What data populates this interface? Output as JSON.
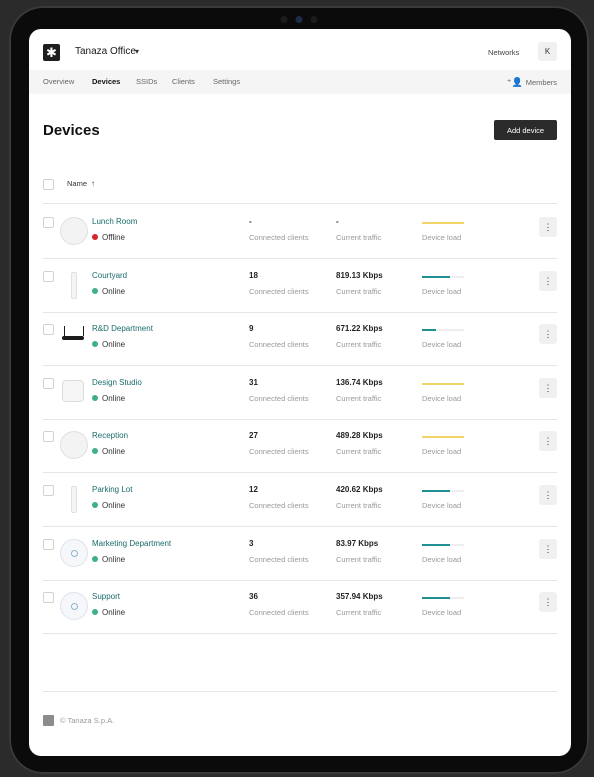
{
  "header": {
    "org_name": "Tanaza Office",
    "networks_label": "Networks",
    "avatar_initial": "K"
  },
  "tabs": [
    {
      "label": "Overview",
      "active": false
    },
    {
      "label": "Devices",
      "active": true
    },
    {
      "label": "SSIDs",
      "active": false
    },
    {
      "label": "Clients",
      "active": false
    },
    {
      "label": "Settings",
      "active": false
    }
  ],
  "members_label": "Members",
  "page": {
    "title": "Devices",
    "add_button": "Add device"
  },
  "table": {
    "column_name": "Name",
    "sort_arrow": "↑"
  },
  "devices": [
    {
      "name": "Lunch Room",
      "status": "Offline",
      "status_color": "#d7262b",
      "clients": "-",
      "traffic": "-",
      "clients_label": "Connected clients",
      "traffic_label": "Current traffic",
      "load_label": "Device load",
      "load": 1.0,
      "load_color": "#f1d46a",
      "thumb": "round"
    },
    {
      "name": "Courtyard",
      "status": "Online",
      "status_color": "#3fae8a",
      "clients": "18",
      "traffic": "819.13 Kbps",
      "clients_label": "Connected clients",
      "traffic_label": "Current traffic",
      "load_label": "Device load",
      "load": 0.67,
      "load_color": "#1f8f92",
      "thumb": "stick"
    },
    {
      "name": "R&D Department",
      "status": "Online",
      "status_color": "#3fae8a",
      "clients": "9",
      "traffic": "671.22 Kbps",
      "clients_label": "Connected clients",
      "traffic_label": "Current traffic",
      "load_label": "Device load",
      "load": 0.33,
      "load_color": "#1f8f92",
      "thumb": "router"
    },
    {
      "name": "Design Studio",
      "status": "Online",
      "status_color": "#3fae8a",
      "clients": "31",
      "traffic": "136.74 Kbps",
      "clients_label": "Connected clients",
      "traffic_label": "Current traffic",
      "load_label": "Device load",
      "load": 1.0,
      "load_color": "#f1d46a",
      "thumb": "square"
    },
    {
      "name": "Reception",
      "status": "Online",
      "status_color": "#3fae8a",
      "clients": "27",
      "traffic": "489.28 Kbps",
      "clients_label": "Connected clients",
      "traffic_label": "Current traffic",
      "load_label": "Device load",
      "load": 1.0,
      "load_color": "#f1d46a",
      "thumb": "round"
    },
    {
      "name": "Parking Lot",
      "status": "Online",
      "status_color": "#3fae8a",
      "clients": "12",
      "traffic": "420.62 Kbps",
      "clients_label": "Connected clients",
      "traffic_label": "Current traffic",
      "load_label": "Device load",
      "load": 0.67,
      "load_color": "#1f8f92",
      "thumb": "stick"
    },
    {
      "name": "Marketing Department",
      "status": "Online",
      "status_color": "#3fae8a",
      "clients": "3",
      "traffic": "83.97 Kbps",
      "clients_label": "Connected clients",
      "traffic_label": "Current traffic",
      "load_label": "Device load",
      "load": 0.67,
      "load_color": "#1f8f92",
      "thumb": "round-blue"
    },
    {
      "name": "Support",
      "status": "Online",
      "status_color": "#3fae8a",
      "clients": "36",
      "traffic": "357.94 Kbps",
      "clients_label": "Connected clients",
      "traffic_label": "Current traffic",
      "load_label": "Device load",
      "load": 0.67,
      "load_color": "#1f8f92",
      "thumb": "round-blue"
    }
  ],
  "footer": {
    "copyright": "© Tanaza S.p.A."
  },
  "icons": {
    "logo": "tanaza-logo-icon",
    "menu": "more-vertical-icon",
    "members": "add-user-icon"
  }
}
